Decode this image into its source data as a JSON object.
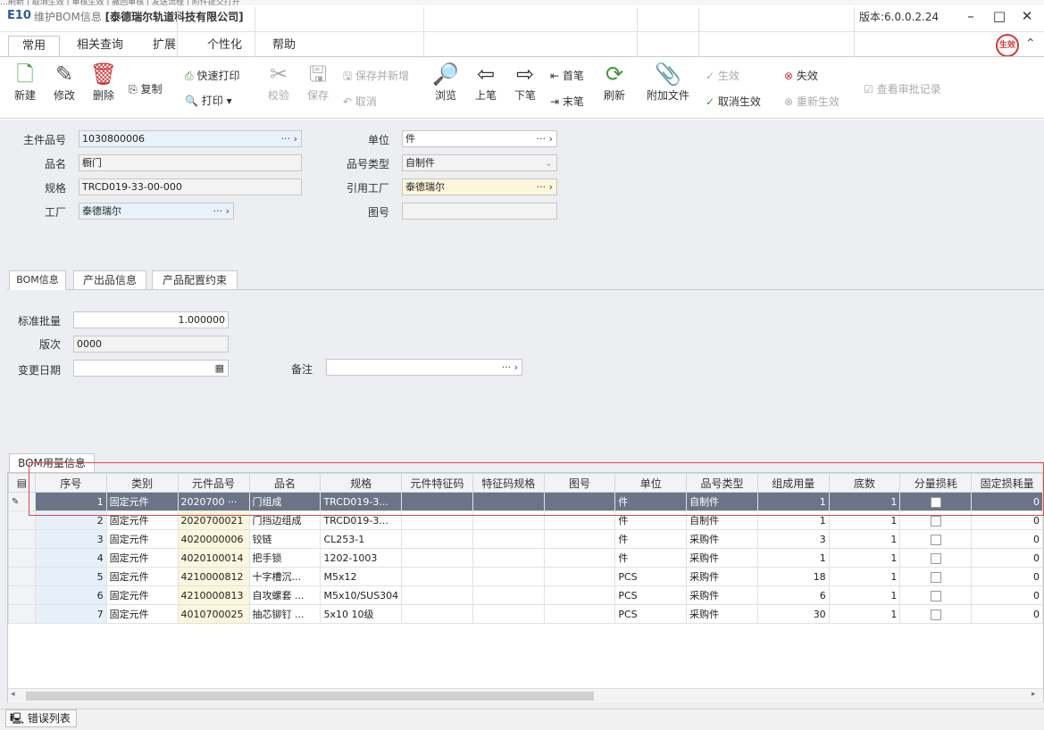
{
  "window": {
    "logo": "E10",
    "title_prefix": "维护BOM信息",
    "company": "[泰德瑞尔轨道科技有限公司]",
    "version": "版本:6.0.0.2.24",
    "min": "–",
    "max": "□",
    "close": "✕",
    "top_strip": "…刷新  | 取消生效  |  审核生效  | 撤回审核 |  发送流程  |  附件提交打开"
  },
  "ribbon_tabs": [
    "常用",
    "相关查询",
    "扩展",
    "个性化",
    "帮助"
  ],
  "stamp": "生效",
  "toolbar": {
    "new": "新建",
    "edit": "修改",
    "delete": "删除",
    "copy": "复制",
    "quick_print": "快速打印",
    "print": "打印",
    "check": "校验",
    "save": "保存",
    "save_new": "保存并新增",
    "cancel": "取消",
    "browse": "浏览",
    "prev": "上笔",
    "next": "下笔",
    "first": "首笔",
    "last": "末笔",
    "refresh": "刷新",
    "attach": "附加文件",
    "effective": "生效",
    "cancel_effective": "取消生效",
    "invalid": "失效",
    "re_effective": "重新生效",
    "approval_log": "查看审批记录"
  },
  "form": {
    "main_part_label": "主件品号",
    "main_part": "1030800006",
    "name_label": "品名",
    "name": "橱门",
    "spec_label": "规格",
    "spec": "TRCD019-33-00-000",
    "factory_label": "工厂",
    "factory": "泰德瑞尔",
    "unit_label": "单位",
    "unit": "件",
    "part_type_label": "品号类型",
    "part_type": "自制件",
    "ref_factory_label": "引用工厂",
    "ref_factory": "泰德瑞尔",
    "drawing_label": "图号",
    "drawing": ""
  },
  "sub_tabs": [
    "BOM信息",
    "产出品信息",
    "产品配置约束"
  ],
  "bom_info": {
    "batch_label": "标准批量",
    "batch": "1.000000",
    "version_label": "版次",
    "version": "0000",
    "change_date_label": "变更日期",
    "change_date": "",
    "remark_label": "备注",
    "remark": ""
  },
  "grid": {
    "tab": "BOM用量信息",
    "columns": [
      "序号",
      "类别",
      "元件品号",
      "品名",
      "规格",
      "元件特征码",
      "特征码规格",
      "图号",
      "单位",
      "品号类型",
      "组成用量",
      "底数",
      "分量损耗",
      "固定损耗量"
    ],
    "rows": [
      [
        "1",
        "固定元件",
        "2020700 ···",
        "门组成",
        "TRCD019-3...",
        "",
        "",
        "",
        "件",
        "自制件",
        "1",
        "1",
        "",
        "0"
      ],
      [
        "2",
        "固定元件",
        "2020700021",
        "门挡边组成",
        "TRCD019-3...",
        "",
        "",
        "",
        "件",
        "自制件",
        "1",
        "1",
        "",
        "0"
      ],
      [
        "3",
        "固定元件",
        "4020000006",
        "铰链",
        "CL253-1",
        "",
        "",
        "",
        "件",
        "采购件",
        "3",
        "1",
        "",
        "0"
      ],
      [
        "4",
        "固定元件",
        "4020100014",
        "把手锁",
        "1202-1003",
        "",
        "",
        "",
        "件",
        "采购件",
        "1",
        "1",
        "",
        "0"
      ],
      [
        "5",
        "固定元件",
        "4210000812",
        "十字槽沉...",
        "M5x12",
        "",
        "",
        "",
        "PCS",
        "采购件",
        "18",
        "1",
        "",
        "0"
      ],
      [
        "6",
        "固定元件",
        "4210000813",
        "自攻螺套 ...",
        "M5x10/SUS304",
        "",
        "",
        "",
        "PCS",
        "采购件",
        "6",
        "1",
        "",
        "0"
      ],
      [
        "7",
        "固定元件",
        "4010700025",
        "抽芯铆钉 ...",
        "5x10 10级",
        "",
        "",
        "",
        "PCS",
        "采购件",
        "30",
        "1",
        "",
        "0"
      ]
    ]
  },
  "status": {
    "error_list": "错误列表"
  }
}
